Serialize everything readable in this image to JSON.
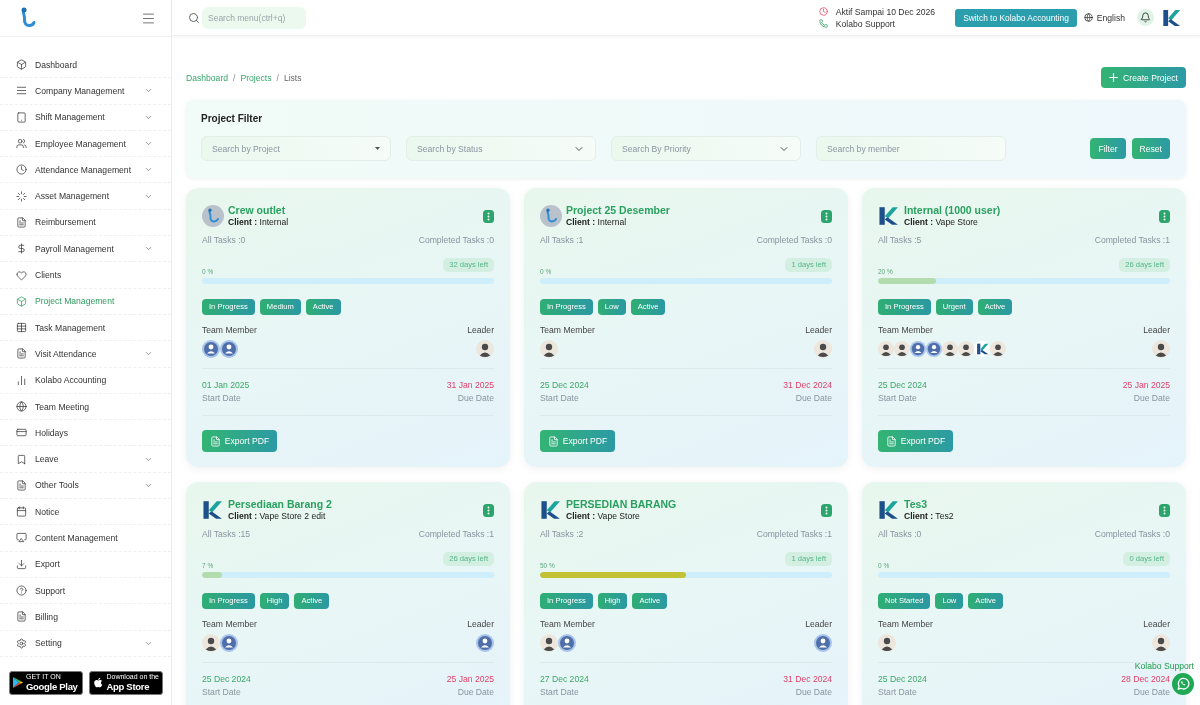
{
  "sidebar": {
    "items": [
      {
        "label": "Dashboard",
        "submenu": false,
        "selected": false
      },
      {
        "label": "Company Management",
        "submenu": true,
        "selected": false
      },
      {
        "label": "Shift Management",
        "submenu": true,
        "selected": false
      },
      {
        "label": "Employee Management",
        "submenu": true,
        "selected": false
      },
      {
        "label": "Attendance Management",
        "submenu": true,
        "selected": false
      },
      {
        "label": "Asset Management",
        "submenu": true,
        "selected": false
      },
      {
        "label": "Reimbursement",
        "submenu": false,
        "selected": false
      },
      {
        "label": "Payroll Management",
        "submenu": true,
        "selected": false
      },
      {
        "label": "Clients",
        "submenu": false,
        "selected": false
      },
      {
        "label": "Project Management",
        "submenu": false,
        "selected": true
      },
      {
        "label": "Task Management",
        "submenu": false,
        "selected": false
      },
      {
        "label": "Visit Attendance",
        "submenu": true,
        "selected": false
      },
      {
        "label": "Kolabo Accounting",
        "submenu": false,
        "selected": false
      },
      {
        "label": "Team Meeting",
        "submenu": false,
        "selected": false
      },
      {
        "label": "Holidays",
        "submenu": false,
        "selected": false
      },
      {
        "label": "Leave",
        "submenu": true,
        "selected": false
      },
      {
        "label": "Other Tools",
        "submenu": true,
        "selected": false
      },
      {
        "label": "Notice",
        "submenu": false,
        "selected": false
      },
      {
        "label": "Content Management",
        "submenu": false,
        "selected": false
      },
      {
        "label": "Export",
        "submenu": false,
        "selected": false
      },
      {
        "label": "Support",
        "submenu": false,
        "selected": false
      },
      {
        "label": "Billing",
        "submenu": false,
        "selected": false
      },
      {
        "label": "Setting",
        "submenu": true,
        "selected": false
      }
    ],
    "store_badges": [
      {
        "kind": "google",
        "caption": "GET IT ON",
        "name": "Google Play"
      },
      {
        "kind": "apple",
        "caption": "Download on the",
        "name": "App Store"
      }
    ]
  },
  "header": {
    "search": {
      "placeholder": "Search menu(ctrl+q)"
    },
    "subscription": "Aktif Sampai 10 Dec 2026",
    "support": "Kolabo Support",
    "switch_button": "Switch to Kolabo Accounting",
    "language": "English"
  },
  "breadcrumb": {
    "separator": "/",
    "items": [
      {
        "label": "Dashboard",
        "current": false
      },
      {
        "label": "Projects",
        "current": false
      },
      {
        "label": "Lists",
        "current": true
      }
    ]
  },
  "create_button": "Create Project",
  "filter": {
    "title": "Project Filter",
    "fields": [
      {
        "kind": "combo",
        "placeholder": "Search by Project"
      },
      {
        "kind": "select",
        "placeholder": "Search by Status"
      },
      {
        "kind": "select",
        "placeholder": "Search By Priority"
      },
      {
        "kind": "text",
        "placeholder": "Search by member"
      }
    ],
    "buttons": [
      "Filter",
      "Reset"
    ]
  },
  "projects": [
    {
      "logo": {
        "kind": "app-logo"
      },
      "title": "Crew outlet",
      "client": "**Client :** Internal",
      "all_tasks": "All Tasks :0",
      "completed_tasks": "Completed Tasks :0",
      "days_left": "32 days left",
      "progress": {
        "label": "0 %"
      },
      "badges": [
        "In Progress",
        "Medium",
        "Active"
      ],
      "team_label": "Team Member",
      "leader_label": "Leader",
      "team": [
        {
          "kind": "default"
        },
        {
          "kind": "default"
        }
      ],
      "leader": {
        "kind": "photo"
      },
      "start_date": "01 Jan 2025",
      "start_label": "Start Date",
      "due_date": "31 Jan 2025",
      "due_label": "Due Date",
      "export_button": "Export PDF"
    },
    {
      "logo": {
        "kind": "app-logo"
      },
      "title": "Project 25 Desember",
      "client": "**Client :** Internal",
      "all_tasks": "All Tasks :1",
      "completed_tasks": "Completed Tasks :0",
      "days_left": "1 days left",
      "progress": {
        "label": "0 %"
      },
      "badges": [
        "In Progress",
        "Low",
        "Active"
      ],
      "team_label": "Team Member",
      "leader_label": "Leader",
      "team": [
        {
          "kind": "photo"
        }
      ],
      "leader": {
        "kind": "photo"
      },
      "start_date": "25 Dec 2024",
      "start_label": "Start Date",
      "due_date": "31 Dec 2024",
      "due_label": "Due Date",
      "export_button": "Export PDF"
    },
    {
      "logo": {
        "kind": "k-logo"
      },
      "title": "Internal (1000 user)",
      "client": "**Client :** Vape Store",
      "all_tasks": "All Tasks :5",
      "completed_tasks": "Completed Tasks :1",
      "days_left": "26 days left",
      "progress": {
        "label": "20 %",
        "level": 0.2,
        "color": "#b3dcae"
      },
      "badges": [
        "In Progress",
        "Urgent",
        "Active"
      ],
      "team_label": "Team Member",
      "leader_label": "Leader",
      "team": [
        {
          "kind": "photo"
        },
        {
          "kind": "photo"
        },
        {
          "kind": "default"
        },
        {
          "kind": "default"
        },
        {
          "kind": "photo"
        },
        {
          "kind": "photo"
        },
        {
          "kind": "logo"
        },
        {
          "kind": "photo"
        }
      ],
      "leader": {
        "kind": "photo"
      },
      "start_date": "25 Dec 2024",
      "start_label": "Start Date",
      "due_date": "25 Jan 2025",
      "due_label": "Due Date",
      "export_button": "Export PDF"
    },
    {
      "logo": {
        "kind": "k-logo"
      },
      "title": "Persediaan Barang 2",
      "client": "**Client :** Vape Store 2 edit",
      "all_tasks": "All Tasks :15",
      "completed_tasks": "Completed Tasks :1",
      "days_left": "26 days left",
      "progress": {
        "label": "7 %",
        "level": 0.07,
        "color": "#b3dcae"
      },
      "badges": [
        "In Progress",
        "High",
        "Active"
      ],
      "team_label": "Team Member",
      "leader_label": "Leader",
      "team": [
        {
          "kind": "photo"
        },
        {
          "kind": "default"
        }
      ],
      "leader": {
        "kind": "default"
      },
      "start_date": "25 Dec 2024",
      "start_label": "Start Date",
      "due_date": "25 Jan 2025",
      "due_label": "Due Date"
    },
    {
      "logo": {
        "kind": "k-logo"
      },
      "title": "PERSEDIAN BARANG",
      "client": "**Client :** Vape Store",
      "all_tasks": "All Tasks :2",
      "completed_tasks": "Completed Tasks :1",
      "days_left": "1 days left",
      "progress": {
        "label": "50 %",
        "level": 0.5,
        "color": "#c2c234"
      },
      "badges": [
        "In Progress",
        "High",
        "Active"
      ],
      "team_label": "Team Member",
      "leader_label": "Leader",
      "team": [
        {
          "kind": "photo"
        },
        {
          "kind": "default"
        }
      ],
      "leader": {
        "kind": "default"
      },
      "start_date": "27 Dec 2024",
      "start_label": "Start Date",
      "due_date": "31 Dec 2024",
      "due_label": "Due Date"
    },
    {
      "logo": {
        "kind": "k-logo"
      },
      "title": "Tes3",
      "client": "**Client :** Tes2",
      "all_tasks": "All Tasks :0",
      "completed_tasks": "Completed Tasks :0",
      "days_left": "0 days left",
      "progress": {
        "label": "0 %"
      },
      "badges": [
        "Not Started",
        "Low",
        "Active"
      ],
      "team_label": "Team Member",
      "leader_label": "Leader",
      "team": [
        {
          "kind": "photo"
        }
      ],
      "leader": {
        "kind": "photo"
      },
      "start_date": "25 Dec 2024",
      "start_label": "Start Date",
      "due_date": "28 Dec 2024",
      "due_label": "Due Date"
    }
  ],
  "floating_support": {
    "label": "Kolabo Support"
  }
}
